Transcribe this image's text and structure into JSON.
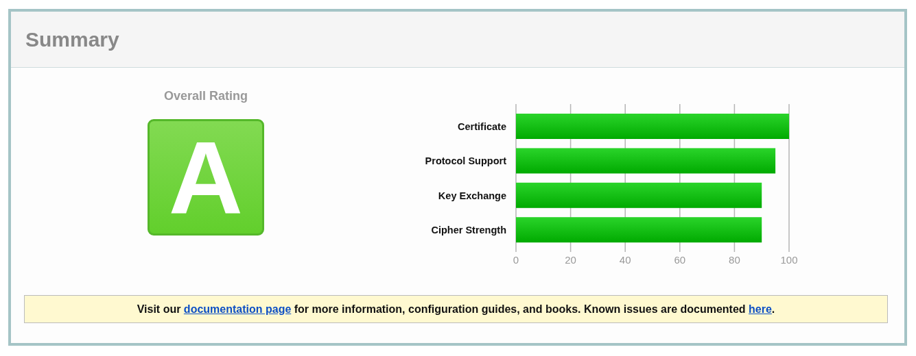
{
  "title": "Summary",
  "rating": {
    "label": "Overall Rating",
    "grade": "A"
  },
  "chart": {
    "chart_data": {
      "type": "bar",
      "orientation": "horizontal",
      "categories": [
        "Certificate",
        "Protocol Support",
        "Key Exchange",
        "Cipher Strength"
      ],
      "series": [
        {
          "color": "#00aa00",
          "values": [
            100,
            95,
            90,
            90
          ]
        }
      ],
      "grid": true,
      "xlim": [
        0,
        100
      ],
      "xticks": [
        0,
        20,
        40,
        60,
        80,
        100
      ]
    }
  },
  "notice": {
    "segments": [
      {
        "kind": "text",
        "text": "Visit our "
      },
      {
        "kind": "link",
        "text": "documentation page"
      },
      {
        "kind": "text",
        "text": " for more information, configuration guides, and books. Known issues are documented "
      },
      {
        "kind": "link",
        "text": "here"
      },
      {
        "kind": "text",
        "text": "."
      }
    ]
  }
}
